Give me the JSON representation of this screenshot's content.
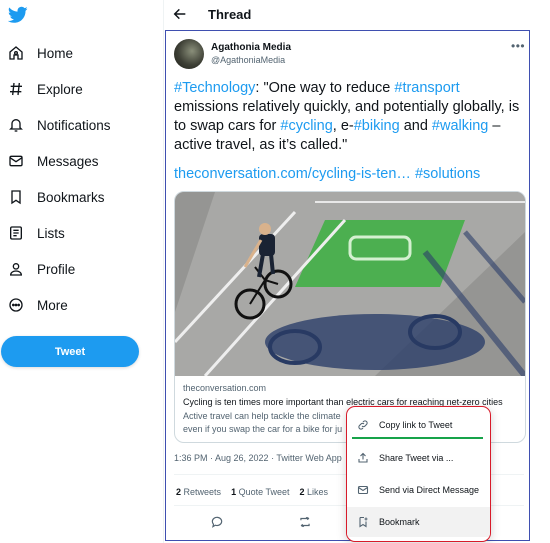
{
  "sidebar": {
    "logo_icon": "twitter-bird-icon",
    "items": [
      {
        "label": "Home",
        "icon": "home-icon"
      },
      {
        "label": "Explore",
        "icon": "hashtag-icon"
      },
      {
        "label": "Notifications",
        "icon": "bell-icon"
      },
      {
        "label": "Messages",
        "icon": "envelope-icon"
      },
      {
        "label": "Bookmarks",
        "icon": "bookmark-icon"
      },
      {
        "label": "Lists",
        "icon": "list-icon"
      },
      {
        "label": "Profile",
        "icon": "person-icon"
      },
      {
        "label": "More",
        "icon": "more-circle-icon"
      }
    ],
    "tweet_button": "Tweet"
  },
  "header": {
    "title": "Thread",
    "back_icon": "arrow-left-icon"
  },
  "tweet": {
    "author_name": "Agathonia Media",
    "author_handle": "@AgathoniaMedia",
    "text": {
      "t1": "#Technology",
      "t2": ": \"One way to reduce ",
      "t3": "#transport",
      "t4": " emissions relatively quickly, and potentially globally, is to swap cars for ",
      "t5": "#cycling",
      "t6": ", e-",
      "t7": "#biking",
      "t8": " and ",
      "t9": "#walking",
      "t10": " – active travel, as it’s called.\""
    },
    "link_url": "theconversation.com/cycling-is-ten…",
    "link_tag": "#solutions",
    "card": {
      "domain": "theconversation.com",
      "title": "Cycling is ten times more important than electric cars for reaching net-zero cities",
      "desc_line1": "Active travel can help tackle the climate",
      "desc_line2": "even if you swap the car for a bike for ju"
    },
    "meta": "1:36 PM · Aug 26, 2022 · Twitter Web App",
    "stats": {
      "retweets_count": "2",
      "retweets_label": "Retweets",
      "quotes_count": "1",
      "quotes_label": "Quote Tweet",
      "likes_count": "2",
      "likes_label": "Likes"
    }
  },
  "share_menu": {
    "items": [
      {
        "label": "Copy link to Tweet",
        "icon": "link-icon"
      },
      {
        "label": "Share Tweet via ...",
        "icon": "share-icon"
      },
      {
        "label": "Send via Direct Message",
        "icon": "envelope-icon"
      },
      {
        "label": "Bookmark",
        "icon": "bookmark-add-icon"
      }
    ]
  },
  "colors": {
    "accent": "#1d9bf0",
    "focus_border": "#3f4fb0",
    "menu_border": "#d81b2a",
    "underline": "#17a34a"
  }
}
